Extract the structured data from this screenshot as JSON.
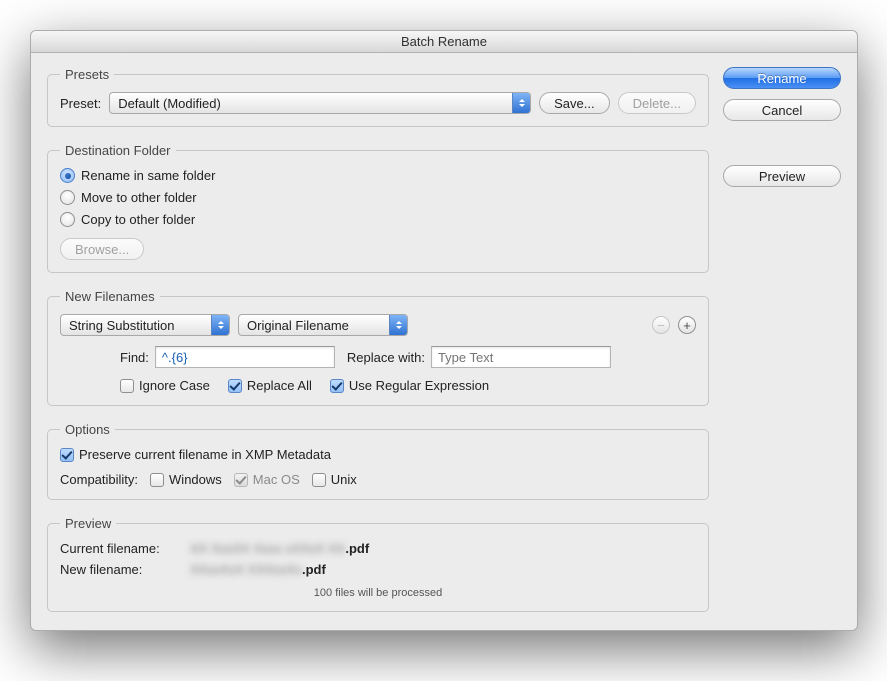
{
  "window": {
    "title": "Batch Rename"
  },
  "sidebar_buttons": {
    "rename": "Rename",
    "cancel": "Cancel",
    "preview": "Preview"
  },
  "presets": {
    "legend": "Presets",
    "label": "Preset:",
    "selected": "Default (Modified)",
    "save": "Save...",
    "delete": "Delete..."
  },
  "destination": {
    "legend": "Destination Folder",
    "options": {
      "same": "Rename in same folder",
      "move": "Move to other folder",
      "copy": "Copy to other folder",
      "selected": "same"
    },
    "browse": "Browse..."
  },
  "filenames": {
    "legend": "New Filenames",
    "mode_selected": "String Substitution",
    "source_selected": "Original Filename",
    "find_label": "Find:",
    "find_value": "^.{6}",
    "replace_label": "Replace with:",
    "replace_value": "",
    "replace_placeholder": "Type Text",
    "ignore_case": {
      "label": "Ignore Case",
      "checked": false
    },
    "replace_all": {
      "label": "Replace All",
      "checked": true
    },
    "use_regex": {
      "label": "Use Regular Expression",
      "checked": true
    }
  },
  "options": {
    "legend": "Options",
    "preserve_xmp": {
      "label": "Preserve current filename in XMP Metadata",
      "checked": true
    },
    "compat_label": "Compatibility:",
    "windows": {
      "label": "Windows",
      "checked": false
    },
    "macos": {
      "label": "Mac OS",
      "checked": true,
      "disabled": true
    },
    "unix": {
      "label": "Unix",
      "checked": false
    }
  },
  "preview": {
    "legend": "Preview",
    "current_label": "Current filename:",
    "current_blur": "XX XxxXX  Xxxx xXXxX  XX",
    "current_ext": ".pdf",
    "new_label": "New filename:",
    "new_blur": "XXxxXxX  XXXxxXx",
    "new_ext": ".pdf",
    "note": "100 files will be processed"
  }
}
